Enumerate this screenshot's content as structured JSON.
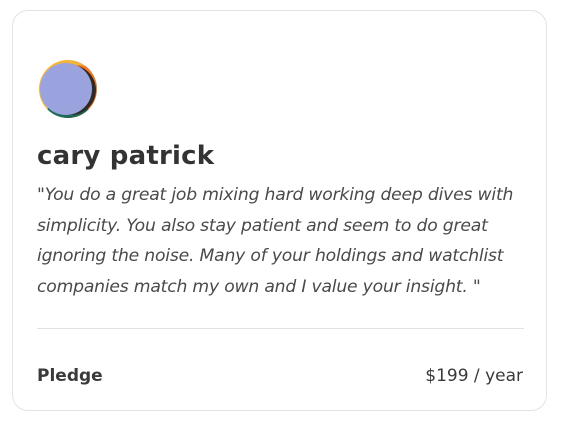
{
  "testimonial": {
    "name": "cary patrick",
    "quote": "\"You do a great job mixing hard working deep dives with simplicity. You also stay patient and seem to do great ignoring the noise. Many of your holdings and watchlist companies match my own and I value your insight. \"",
    "avatar_icon": "avatar-circle-icon"
  },
  "footer": {
    "label": "Pledge",
    "price": "$199 / year"
  },
  "colors": {
    "avatar_main": "#9aa3dd",
    "avatar_orange": "#f07a2a",
    "avatar_yellow": "#f2b53b",
    "avatar_teal": "#1e6b5a",
    "card_border": "#e3e3e3",
    "text": "#3a3a3a"
  }
}
